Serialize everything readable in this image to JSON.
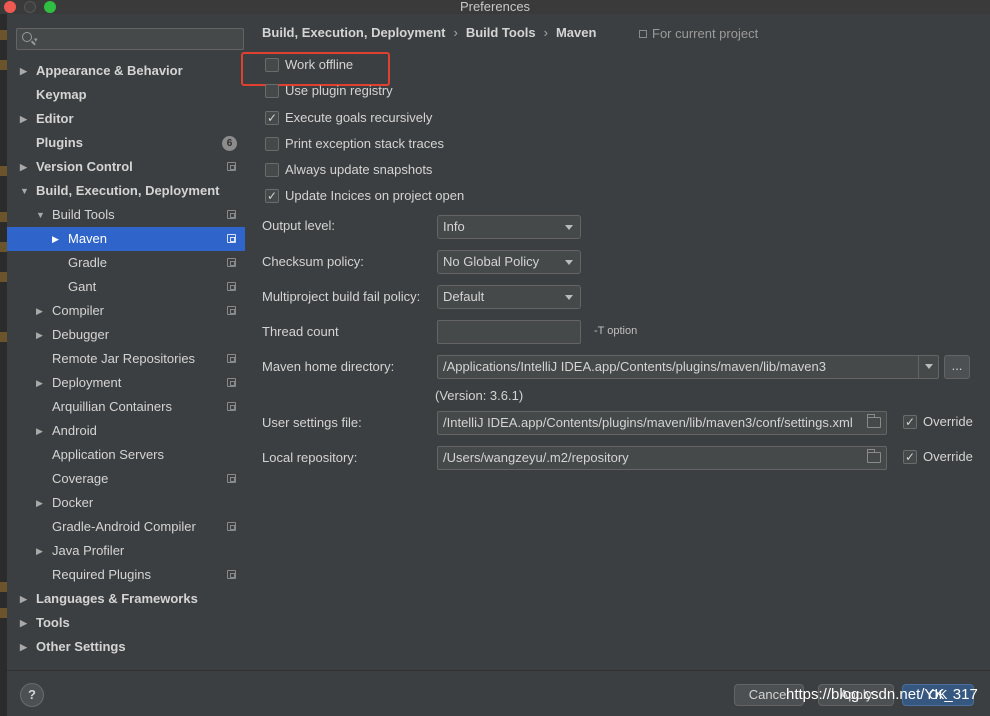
{
  "window": {
    "title": "Preferences"
  },
  "search": {
    "placeholder": ""
  },
  "sidebar": {
    "items": [
      {
        "label": "Appearance & Behavior"
      },
      {
        "label": "Keymap"
      },
      {
        "label": "Editor"
      },
      {
        "label": "Plugins",
        "badge": "6"
      },
      {
        "label": "Version Control"
      },
      {
        "label": "Build, Execution, Deployment"
      },
      {
        "label": "Build Tools"
      },
      {
        "label": "Maven"
      },
      {
        "label": "Gradle"
      },
      {
        "label": "Gant"
      },
      {
        "label": "Compiler"
      },
      {
        "label": "Debugger"
      },
      {
        "label": "Remote Jar Repositories"
      },
      {
        "label": "Deployment"
      },
      {
        "label": "Arquillian Containers"
      },
      {
        "label": "Android"
      },
      {
        "label": "Application Servers"
      },
      {
        "label": "Coverage"
      },
      {
        "label": "Docker"
      },
      {
        "label": "Gradle-Android Compiler"
      },
      {
        "label": "Java Profiler"
      },
      {
        "label": "Required Plugins"
      },
      {
        "label": "Languages & Frameworks"
      },
      {
        "label": "Tools"
      },
      {
        "label": "Other Settings"
      }
    ]
  },
  "breadcrumb": {
    "parts": [
      "Build, Execution, Deployment",
      "Build Tools",
      "Maven"
    ],
    "separator": "›",
    "scope": "For current project"
  },
  "options": [
    {
      "label": "Work offline",
      "checked": false
    },
    {
      "label": "Use plugin registry",
      "checked": false
    },
    {
      "label": "Execute goals recursively",
      "checked": true
    },
    {
      "label": "Print exception stack traces",
      "checked": false
    },
    {
      "label": "Always update snapshots",
      "checked": false
    },
    {
      "label": "Update Incices on project open",
      "checked": true
    }
  ],
  "fields": {
    "output_level": {
      "label": "Output level:",
      "value": "Info"
    },
    "checksum_policy": {
      "label": "Checksum policy:",
      "value": "No Global Policy"
    },
    "fail_policy": {
      "label": "Multiproject build fail policy:",
      "value": "Default"
    },
    "thread_count": {
      "label": "Thread count",
      "value": "",
      "hint": "-T option"
    },
    "maven_home": {
      "label": "Maven home directory:",
      "value": "/Applications/IntelliJ IDEA.app/Contents/plugins/maven/lib/maven3",
      "browse": "...",
      "version": "(Version: 3.6.1)"
    },
    "user_settings": {
      "label": "User settings file:",
      "value": "/IntelliJ IDEA.app/Contents/plugins/maven/lib/maven3/conf/settings.xml",
      "override_label": "Override",
      "override": true
    },
    "local_repo": {
      "label": "Local repository:",
      "value": "/Users/wangzeyu/.m2/repository",
      "override_label": "Override",
      "override": true
    }
  },
  "buttons": {
    "help": "?",
    "cancel": "Cancel",
    "apply": "Apply",
    "ok": "OK"
  },
  "watermark": "https://blog.csdn.net/YK_317",
  "colors": {
    "selection": "#2f65ca",
    "highlight": "#e0402f",
    "ok": "#365880"
  }
}
